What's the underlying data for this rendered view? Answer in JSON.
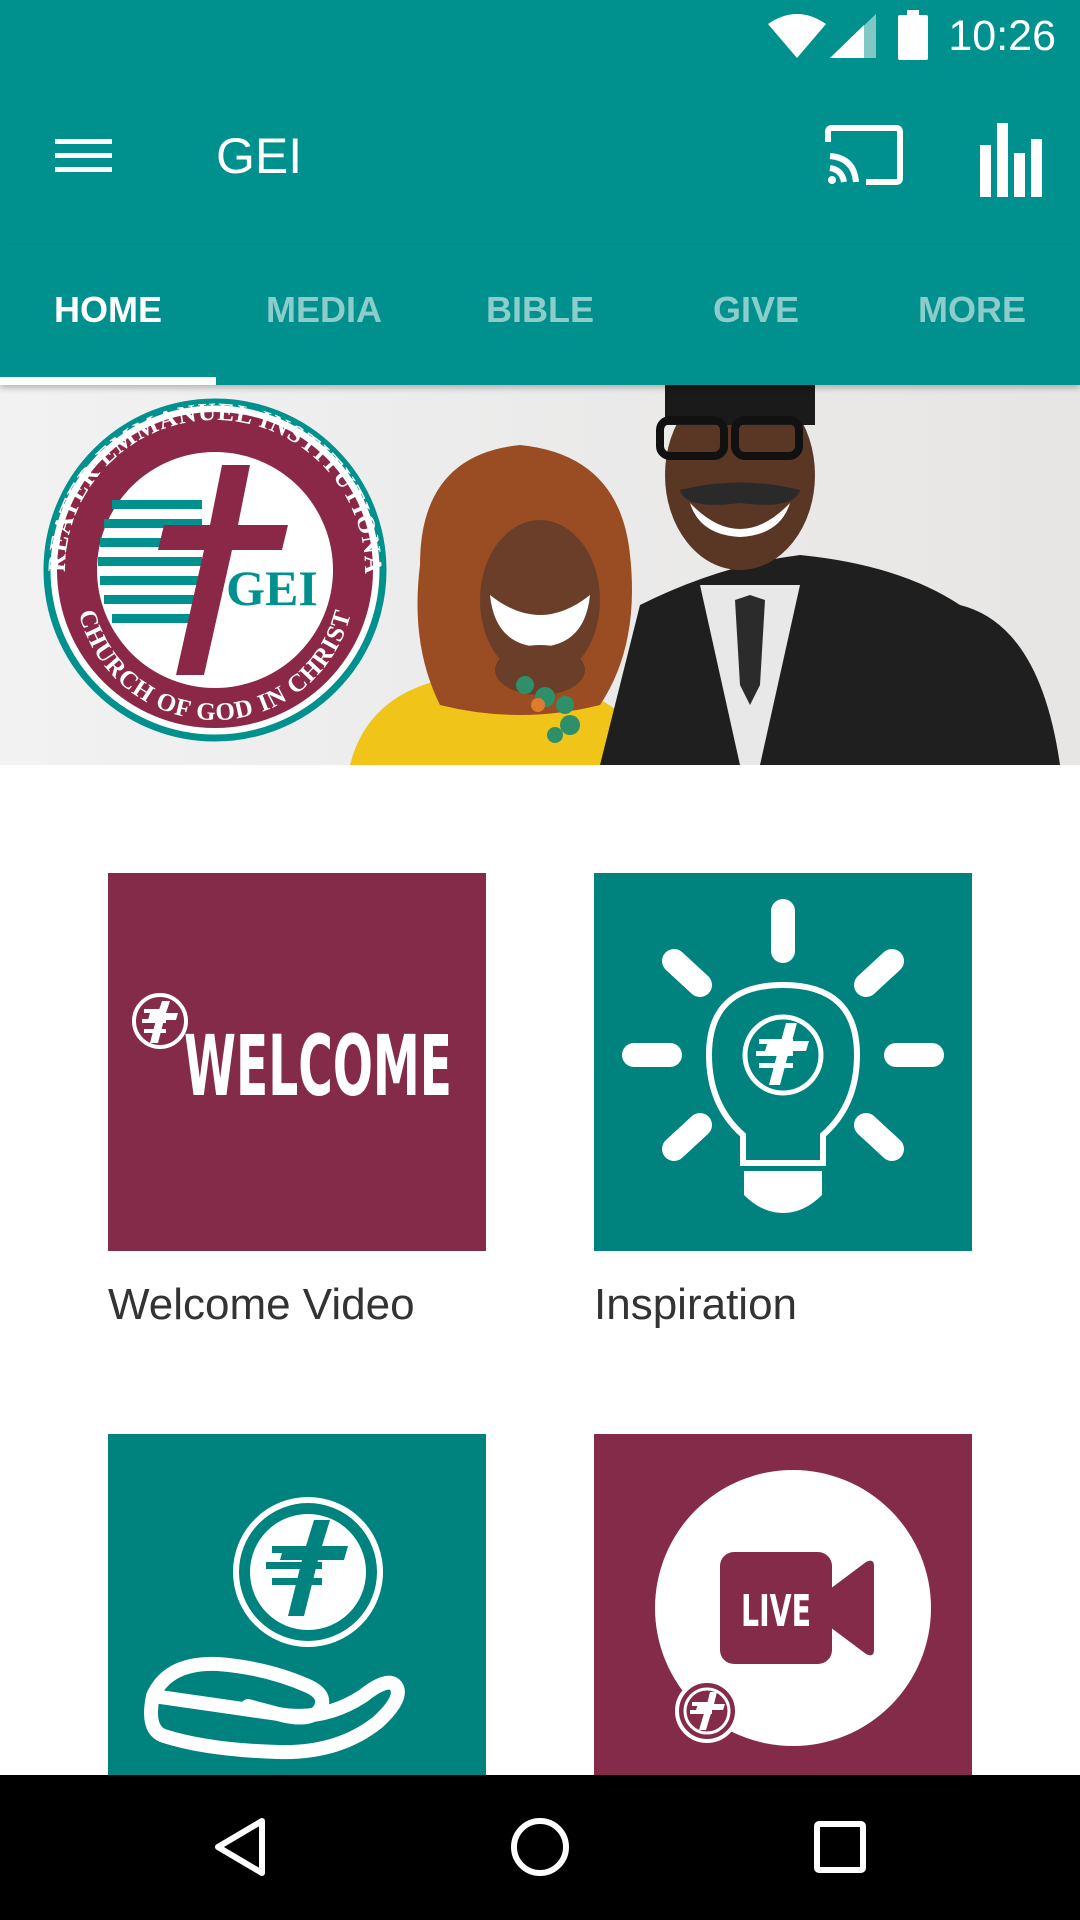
{
  "status_bar": {
    "time": "10:26"
  },
  "app_bar": {
    "title": "GEI"
  },
  "tabs": [
    {
      "label": "HOME"
    },
    {
      "label": "MEDIA"
    },
    {
      "label": "BIBLE"
    },
    {
      "label": "GIVE"
    },
    {
      "label": "MORE"
    }
  ],
  "active_tab": "HOME",
  "hero": {
    "logo_text": {
      "org_name_top": "GREATER EMMANUEL INSTITUTIONAL",
      "org_name_bottom": "CHURCH OF GOD IN CHRIST",
      "monogram": "GEI"
    }
  },
  "tiles": [
    {
      "label": "Welcome Video",
      "art_text": "WELCOME"
    },
    {
      "label": "Inspiration"
    },
    {
      "label": ""
    },
    {
      "label": "",
      "art_text": "LIVE"
    }
  ],
  "colors": {
    "primary_teal": "#00908D",
    "tile_teal": "#00827E",
    "tile_maroon": "#842B4A",
    "seal_maroon": "#8B2847"
  },
  "icons": {
    "menu": "hamburger-menu-icon",
    "cast": "cast-icon",
    "stats": "bar-chart-icon",
    "nav_back": "back-triangle-icon",
    "nav_home": "home-circle-icon",
    "nav_recents": "recents-square-icon"
  }
}
